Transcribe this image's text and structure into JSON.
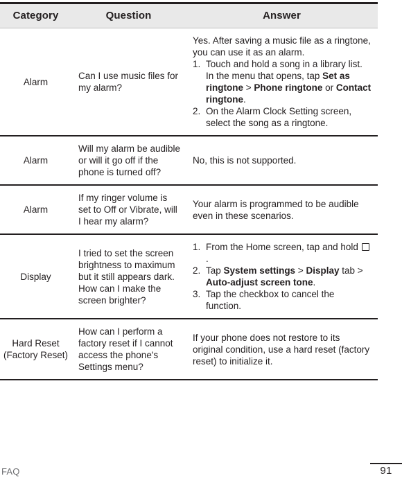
{
  "document": {
    "footer_label": "FAQ",
    "page_number": "91"
  },
  "table": {
    "headers": {
      "category": "Category",
      "question": "Question",
      "answer": "Answer"
    },
    "rows": [
      {
        "category": "Alarm",
        "question": "Can I use music files for my alarm?",
        "answer_intro": "Yes. After saving a music file as a ringtone, you can use it as an alarm.",
        "steps": [
          {
            "num": "1.",
            "parts": [
              {
                "text": "Touch and hold a song in a library list. In the menu that opens, tap ",
                "style": "normal"
              },
              {
                "text": "Set as ringtone",
                "style": "bold"
              },
              {
                "text": " > ",
                "style": "normal"
              },
              {
                "text": "Phone ringtone",
                "style": "bold"
              },
              {
                "text": " or ",
                "style": "normal"
              },
              {
                "text": "Contact ringtone",
                "style": "bold"
              },
              {
                "text": ".",
                "style": "normal"
              }
            ]
          },
          {
            "num": "2.",
            "parts": [
              {
                "text": "On the Alarm Clock Setting screen, select the song as a ringtone.",
                "style": "normal"
              }
            ]
          }
        ]
      },
      {
        "category": "Alarm",
        "question": "Will my alarm be audible or will it go off if the phone is turned off?",
        "answer_intro": "No, this is not supported.",
        "steps": []
      },
      {
        "category": "Alarm",
        "question": "If my ringer volume is set to Off or Vibrate, will I hear my alarm?",
        "answer_intro": "Your alarm is programmed to be audible even in these scenarios.",
        "steps": []
      },
      {
        "category": "Display",
        "question": "I tried to set the screen brightness to maximum but it still appears dark. How can I make the screen brighter?",
        "answer_intro": "",
        "steps": [
          {
            "num": "1.",
            "parts": [
              {
                "text": "From the Home screen, tap and hold ",
                "style": "normal"
              },
              {
                "icon": "menu-key-square-icon"
              },
              {
                "text": ".",
                "style": "normal"
              }
            ]
          },
          {
            "num": "2.",
            "parts": [
              {
                "text": "Tap ",
                "style": "normal"
              },
              {
                "text": "System settings",
                "style": "bold"
              },
              {
                "text": " > ",
                "style": "normal"
              },
              {
                "text": "Display",
                "style": "bold"
              },
              {
                "text": " tab > ",
                "style": "normal"
              },
              {
                "text": "Auto-adjust screen tone",
                "style": "bold"
              },
              {
                "text": ".",
                "style": "normal"
              }
            ]
          },
          {
            "num": "3.",
            "parts": [
              {
                "text": "Tap the checkbox to cancel the function.",
                "style": "normal"
              }
            ]
          }
        ]
      },
      {
        "category": "Hard Reset (Factory Reset)",
        "question": "How can I perform a factory reset if I cannot access the phone's Settings menu?",
        "answer_intro": "If your phone does not restore to its original condition, use a hard reset (factory reset) to initialize it.",
        "steps": []
      }
    ]
  },
  "colors": {
    "ink": "#231f20",
    "header_bg": "#e9e9e9",
    "footer_text": "#6d6e71"
  }
}
